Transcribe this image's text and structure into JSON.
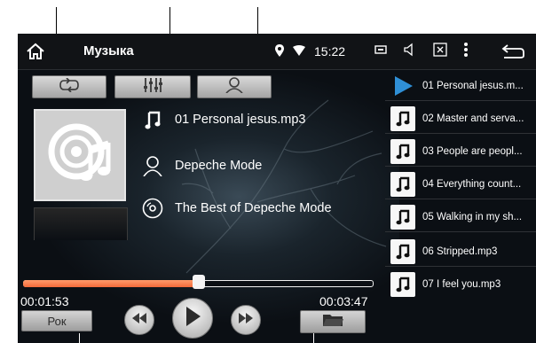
{
  "app": {
    "title": "Музыка"
  },
  "status": {
    "time": "15:22"
  },
  "track": {
    "file": "01 Personal jesus.mp3",
    "artist": "Depeche Mode",
    "album": "The Best of Depeche Mode"
  },
  "playback": {
    "elapsed": "00:01:53",
    "total": "00:03:47",
    "progress": 0.5
  },
  "genre": {
    "label": "Рок"
  },
  "colors": {
    "accent": "#f26a3a",
    "background": "#0b0f14",
    "playing_icon": "#2f8fd6"
  },
  "playlist": [
    {
      "label": "01 Personal jesus.m...",
      "playing": true
    },
    {
      "label": "02 Master and serva...",
      "playing": false
    },
    {
      "label": "03 People are peopl...",
      "playing": false
    },
    {
      "label": "04 Everything count...",
      "playing": false
    },
    {
      "label": "05 Walking in my sh...",
      "playing": false
    },
    {
      "label": "06 Stripped.mp3",
      "playing": false
    },
    {
      "label": "07 I feel you.mp3",
      "playing": false
    }
  ]
}
